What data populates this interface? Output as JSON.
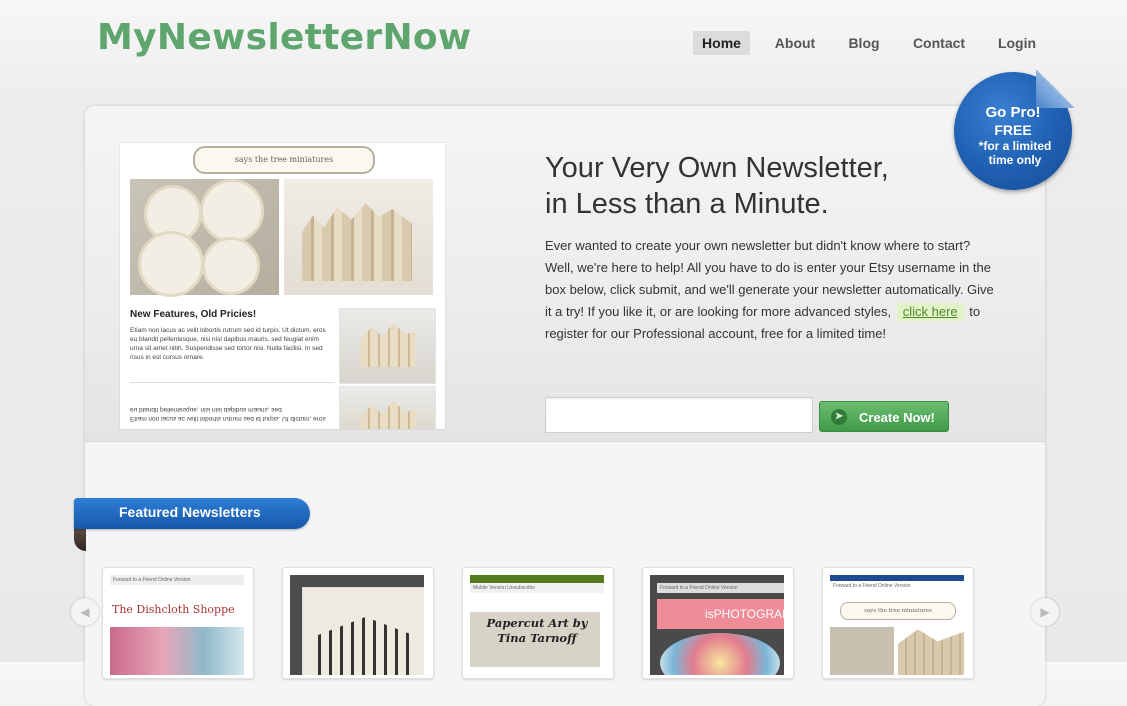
{
  "brand": {
    "logo": "MyNewsletterNow",
    "accent": "#5ea66e"
  },
  "nav": {
    "items": [
      {
        "label": "Home",
        "active": true
      },
      {
        "label": "About",
        "active": false
      },
      {
        "label": "Blog",
        "active": false
      },
      {
        "label": "Contact",
        "active": false
      },
      {
        "label": "Login",
        "active": false
      }
    ]
  },
  "hero": {
    "headline_line1": "Your Very Own Newsletter,",
    "headline_line2": "in Less than a Minute.",
    "intro_before": "Ever wanted to create your own newsletter but didn't know where to start? Well, we're here to help! All you have to do is enter your Etsy username in the box below, click submit, and we'll generate your newsletter automatically. Give it a try! If you like it, or are looking for more advanced styles,",
    "intro_link": "click here",
    "intro_after": "to register for our Professional account, free for a limited time!",
    "username_input": {
      "value": "",
      "placeholder": ""
    },
    "create_button": "Create Now!"
  },
  "preview": {
    "banner": "says the tree miniatures",
    "heading": "New Features, Old Pricies!",
    "body": "Etiam non lacus ac velit lobortis rutrum sed id turpis. Ut dictum, eros eu blandit pellentesque, nisi nisl dapibus mauris, sed feugiat enim urna sit amet nibh. Suspendisse sed tortor nisi. Nulla facilisi. In sed risus in est cursus ornare.",
    "footer_text": "Etiam non lacus ac velit lobortis rutrum sed id turpis. Ut dictum, eros eu blandit pellentesque, nisi nisl dapibus mauris, sed"
  },
  "badge": {
    "line1": "Go Pro!",
    "line2": "FREE",
    "line3": "*for a limited time only",
    "color": "#1f5fb2"
  },
  "featured": {
    "tab_label": "Featured Newsletters",
    "tab_color": "#1e68c0",
    "prev_icon": "◀",
    "next_icon": "▶",
    "thumbs": [
      {
        "bar": "Forward to a Friend    Online Version",
        "title": "The Dishcloth Shoppe"
      },
      {
        "bar": "",
        "title": ""
      },
      {
        "bar": "Mobile Version    Unsubscribe",
        "title": "Papercut Art by Tina Tarnoff"
      },
      {
        "bar": "Forward to a Friend    Online Version",
        "title": "isPHOTOGRAPH"
      },
      {
        "bar": "Forward to a Friend    Online Version",
        "title": "says the tree miniatures"
      }
    ]
  }
}
